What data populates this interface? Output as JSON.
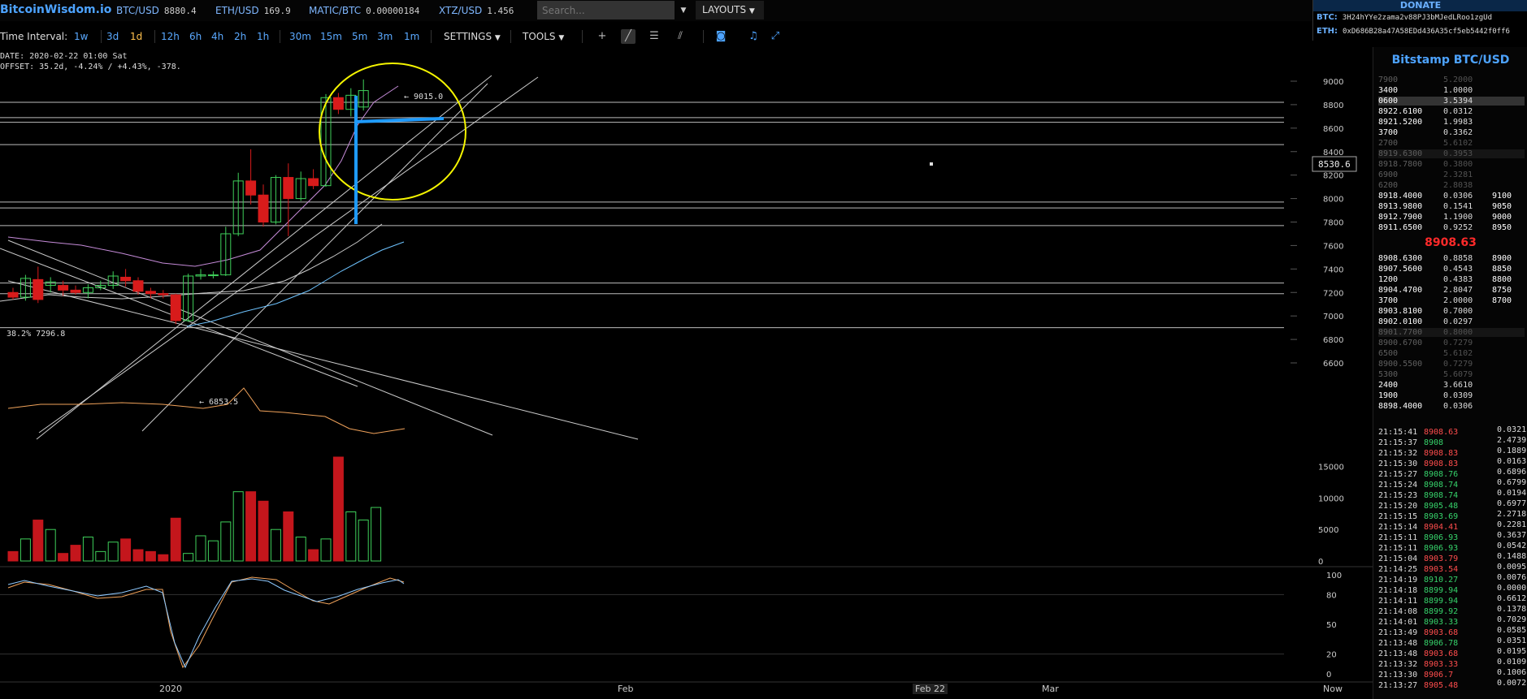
{
  "header": {
    "logo": "BitcoinWisdom.io",
    "tickers": [
      {
        "sym": "BTC/USD",
        "val": "8880.4"
      },
      {
        "sym": "ETH/USD",
        "val": "169.9"
      },
      {
        "sym": "MATIC/BTC",
        "val": "0.00000184"
      },
      {
        "sym": "XTZ/USD",
        "val": "1.456"
      }
    ],
    "search_placeholder": "Search...",
    "layouts_label": "LAYOUTS"
  },
  "donate": {
    "title": "DONATE",
    "btc_label": "BTC:",
    "btc_addr": "3H24hYYe2zama2v88PJ3bMJedLRoo1zgUd",
    "eth_label": "ETH:",
    "eth_addr": "0xD686B28a47A58EDd436A35cf5eb5442f0ff6"
  },
  "toolbar": {
    "label": "Time Interval:",
    "intervals": [
      "1w",
      "3d",
      "1d",
      "12h",
      "6h",
      "4h",
      "2h",
      "1h",
      "30m",
      "15m",
      "5m",
      "3m",
      "1m"
    ],
    "selected": "1d",
    "settings": "SETTINGS",
    "tools": "TOOLS"
  },
  "info": {
    "date": "DATE: 2020-02-22 01:00 Sat",
    "offset": "OFFSET: 35.2d, -4.24% / +4.43%, -378."
  },
  "chart_annotations": {
    "fib": "38.2% 7296.8",
    "high": "← 9015.0",
    "low": "← 6853.5",
    "price_marker": "8530.6"
  },
  "chart_data": {
    "type": "candlestick",
    "y_ticks": [
      "9000",
      "8800",
      "8600",
      "8400",
      "8200",
      "8000",
      "7800",
      "7600",
      "7400",
      "7200",
      "7000",
      "6800",
      "6600"
    ],
    "ylim": [
      6600,
      9000
    ],
    "volume_ticks": [
      "15000",
      "10000",
      "5000",
      "0"
    ],
    "osc_ticks": [
      "100",
      "80",
      "50",
      "20",
      "0"
    ],
    "x_labels": [
      "2020",
      "Feb",
      "Feb 22",
      "Mar",
      "Now"
    ],
    "candles": [
      {
        "o": 7200,
        "c": 7160,
        "h": 7240,
        "l": 7140
      },
      {
        "o": 7160,
        "c": 7320,
        "h": 7350,
        "l": 7130
      },
      {
        "o": 7310,
        "c": 7140,
        "h": 7420,
        "l": 7110
      },
      {
        "o": 7260,
        "c": 7290,
        "h": 7330,
        "l": 7200
      },
      {
        "o": 7260,
        "c": 7220,
        "h": 7300,
        "l": 7170
      },
      {
        "o": 7220,
        "c": 7200,
        "h": 7260,
        "l": 7180
      },
      {
        "o": 7200,
        "c": 7240,
        "h": 7270,
        "l": 7150
      },
      {
        "o": 7240,
        "c": 7260,
        "h": 7300,
        "l": 7220
      },
      {
        "o": 7260,
        "c": 7340,
        "h": 7380,
        "l": 7230
      },
      {
        "o": 7330,
        "c": 7300,
        "h": 7400,
        "l": 7250
      },
      {
        "o": 7300,
        "c": 7210,
        "h": 7330,
        "l": 7180
      },
      {
        "o": 7210,
        "c": 7190,
        "h": 7240,
        "l": 7150
      },
      {
        "o": 7190,
        "c": 7180,
        "h": 7220,
        "l": 7150
      },
      {
        "o": 7180,
        "c": 6960,
        "h": 7190,
        "l": 6930
      },
      {
        "o": 6960,
        "c": 7340,
        "h": 7360,
        "l": 6950
      },
      {
        "o": 7340,
        "c": 7350,
        "h": 7400,
        "l": 7310
      },
      {
        "o": 7350,
        "c": 7350,
        "h": 7380,
        "l": 7320
      },
      {
        "o": 7350,
        "c": 7700,
        "h": 7760,
        "l": 7340
      },
      {
        "o": 7700,
        "c": 8150,
        "h": 8220,
        "l": 7680
      },
      {
        "o": 8150,
        "c": 8030,
        "h": 8420,
        "l": 7950
      },
      {
        "o": 8030,
        "c": 7800,
        "h": 8120,
        "l": 7760
      },
      {
        "o": 7800,
        "c": 8180,
        "h": 8200,
        "l": 7780
      },
      {
        "o": 8180,
        "c": 8000,
        "h": 8300,
        "l": 7680
      },
      {
        "o": 8000,
        "c": 8170,
        "h": 8230,
        "l": 7980
      },
      {
        "o": 8170,
        "c": 8110,
        "h": 8250,
        "l": 8080
      },
      {
        "o": 8110,
        "c": 8860,
        "h": 8890,
        "l": 8100
      },
      {
        "o": 8860,
        "c": 8760,
        "h": 8900,
        "l": 8720
      },
      {
        "o": 8760,
        "c": 8880,
        "h": 8940,
        "l": 8700
      },
      {
        "o": 8780,
        "c": 8920,
        "h": 9015,
        "l": 8750
      }
    ],
    "volumes": [
      1500,
      3500,
      6500,
      5000,
      1200,
      2500,
      3800,
      1500,
      3000,
      3500,
      1800,
      1500,
      1000,
      6800,
      1200,
      4000,
      3200,
      6200,
      11000,
      11000,
      9500,
      5000,
      7800,
      3800,
      1800,
      3500,
      16500,
      7800,
      6500,
      8500
    ]
  },
  "sidebar": {
    "title": "Bitstamp BTC/USD",
    "mid_price": "8908.63",
    "asks": [
      {
        "p": "7900",
        "a": "5.2000",
        "d": "",
        "dim": true
      },
      {
        "p": "3400",
        "a": "1.0000",
        "d": "",
        "dim": false
      },
      {
        "p": "0600",
        "a": "3.5394",
        "d": "",
        "dim": false,
        "hl": true
      },
      {
        "p": "8922.6100",
        "a": "0.0312",
        "d": "",
        "dim": false
      },
      {
        "p": "8921.5200",
        "a": "1.9983",
        "d": "",
        "dim": false
      },
      {
        "p": "3700",
        "a": "0.3362",
        "d": "",
        "dim": false
      },
      {
        "p": "2700",
        "a": "5.6102",
        "d": "",
        "dim": true
      },
      {
        "p": "8919.6300",
        "a": "0.3953",
        "d": "",
        "dim": true,
        "hl": true
      },
      {
        "p": "8918.7800",
        "a": "0.3800",
        "d": "",
        "dim": true
      },
      {
        "p": "6900",
        "a": "2.3281",
        "d": "",
        "dim": true
      },
      {
        "p": "6200",
        "a": "2.8038",
        "d": "",
        "dim": true
      },
      {
        "p": "8918.4000",
        "a": "0.0306",
        "d": "9100",
        "dim": false
      },
      {
        "p": "8913.9800",
        "a": "0.1541",
        "d": "9050",
        "dim": false
      },
      {
        "p": "8912.7900",
        "a": "1.1900",
        "d": "9000",
        "dim": false
      },
      {
        "p": "8911.6500",
        "a": "0.9252",
        "d": "8950",
        "dim": false
      }
    ],
    "bids": [
      {
        "p": "8908.6300",
        "a": "0.8858",
        "d": "8900",
        "dim": false
      },
      {
        "p": "8907.5600",
        "a": "0.4543",
        "d": "8850",
        "dim": false
      },
      {
        "p": "1200",
        "a": "0.4383",
        "d": "8800",
        "dim": false
      },
      {
        "p": "8904.4700",
        "a": "2.8047",
        "d": "8750",
        "dim": false
      },
      {
        "p": "3700",
        "a": "2.0000",
        "d": "8700",
        "dim": false
      },
      {
        "p": "8903.8100",
        "a": "0.7000",
        "d": "",
        "dim": false
      },
      {
        "p": "8902.0100",
        "a": "0.0297",
        "d": "",
        "dim": false
      },
      {
        "p": "8901.7700",
        "a": "0.8000",
        "d": "",
        "dim": true,
        "hl": true
      },
      {
        "p": "8900.6700",
        "a": "0.7279",
        "d": "",
        "dim": true
      },
      {
        "p": "6500",
        "a": "5.6102",
        "d": "",
        "dim": true
      },
      {
        "p": "8900.5500",
        "a": "0.7279",
        "d": "",
        "dim": true
      },
      {
        "p": "5300",
        "a": "5.6079",
        "d": "",
        "dim": true
      },
      {
        "p": "2400",
        "a": "3.6610",
        "d": "",
        "dim": false
      },
      {
        "p": "1900",
        "a": "0.0309",
        "d": "",
        "dim": false
      },
      {
        "p": "8898.4000",
        "a": "0.0306",
        "d": "",
        "dim": false
      }
    ],
    "trades": [
      {
        "t": "21:15:41",
        "p": "8908.63",
        "q": "0.0321",
        "dir": "down"
      },
      {
        "t": "21:15:37",
        "p": "8908",
        "q": "2.4739",
        "dir": "up"
      },
      {
        "t": "21:15:32",
        "p": "8908.83",
        "q": "0.1889",
        "dir": "down"
      },
      {
        "t": "21:15:30",
        "p": "8908.83",
        "q": "0.0163",
        "dir": "down"
      },
      {
        "t": "21:15:27",
        "p": "8908.76",
        "q": "0.6896",
        "dir": "up"
      },
      {
        "t": "21:15:24",
        "p": "8908.74",
        "q": "0.6799",
        "dir": "up"
      },
      {
        "t": "21:15:23",
        "p": "8908.74",
        "q": "0.0194",
        "dir": "up"
      },
      {
        "t": "21:15:20",
        "p": "8905.48",
        "q": "0.6977",
        "dir": "up"
      },
      {
        "t": "21:15:15",
        "p": "8903.69",
        "q": "2.2718",
        "dir": "up"
      },
      {
        "t": "21:15:14",
        "p": "8904.41",
        "q": "0.2281",
        "dir": "down"
      },
      {
        "t": "21:15:11",
        "p": "8906.93",
        "q": "0.3637",
        "dir": "up"
      },
      {
        "t": "21:15:11",
        "p": "8906.93",
        "q": "0.0542",
        "dir": "up"
      },
      {
        "t": "21:15:04",
        "p": "8903.79",
        "q": "0.1488",
        "dir": "down"
      },
      {
        "t": "21:14:25",
        "p": "8903.54",
        "q": "0.0095",
        "dir": "down"
      },
      {
        "t": "21:14:19",
        "p": "8910.27",
        "q": "0.0076",
        "dir": "up"
      },
      {
        "t": "21:14:18",
        "p": "8899.94",
        "q": "0.0000",
        "dir": "up"
      },
      {
        "t": "21:14:11",
        "p": "8899.94",
        "q": "0.6612",
        "dir": "up"
      },
      {
        "t": "21:14:08",
        "p": "8899.92",
        "q": "0.1378",
        "dir": "up"
      },
      {
        "t": "21:14:01",
        "p": "8903.33",
        "q": "0.7029",
        "dir": "up"
      },
      {
        "t": "21:13:49",
        "p": "8903.68",
        "q": "0.0585",
        "dir": "down"
      },
      {
        "t": "21:13:48",
        "p": "8906.78",
        "q": "0.0351",
        "dir": "up"
      },
      {
        "t": "21:13:48",
        "p": "8903.68",
        "q": "0.0195",
        "dir": "down"
      },
      {
        "t": "21:13:32",
        "p": "8903.33",
        "q": "0.0109",
        "dir": "down"
      },
      {
        "t": "21:13:30",
        "p": "8906.7",
        "q": "0.1006",
        "dir": "down"
      },
      {
        "t": "21:13:27",
        "p": "8905.48",
        "q": "0.0072",
        "dir": "down"
      }
    ]
  }
}
